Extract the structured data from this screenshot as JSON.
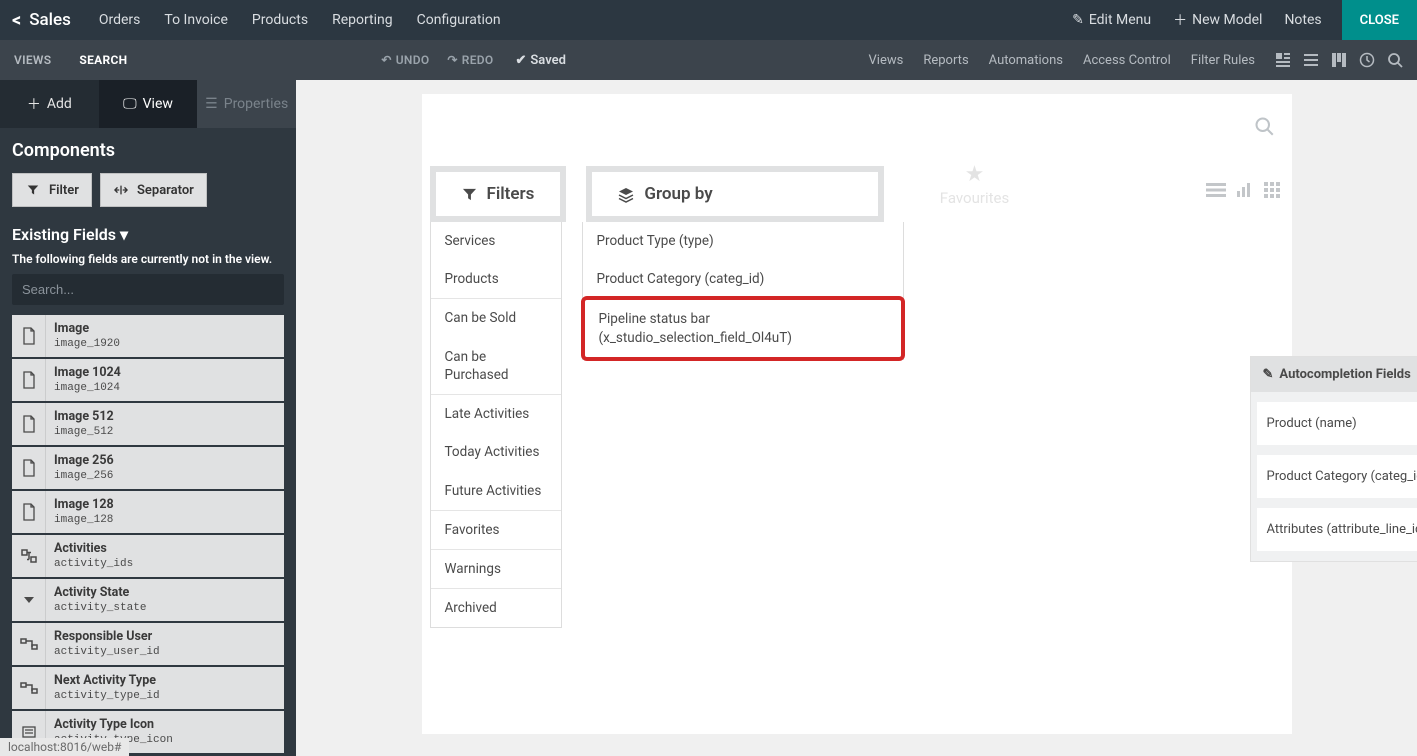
{
  "topbar": {
    "app": "Sales",
    "menus": [
      "Orders",
      "To Invoice",
      "Products",
      "Reporting",
      "Configuration"
    ],
    "edit_menu": "Edit Menu",
    "new_model": "New Model",
    "notes": "Notes",
    "close": "CLOSE"
  },
  "toolbar2": {
    "tabs": {
      "views": "VIEWS",
      "search": "SEARCH"
    },
    "undo": "UNDO",
    "redo": "REDO",
    "saved": "Saved",
    "rlinks": [
      "Views",
      "Reports",
      "Automations",
      "Access Control",
      "Filter Rules"
    ]
  },
  "side_tabs": {
    "add": "Add",
    "view": "View",
    "props": "Properties"
  },
  "components": {
    "title": "Components",
    "filter": "Filter",
    "separator": "Separator"
  },
  "existing": {
    "title": "Existing Fields",
    "subtitle": "The following fields are currently not in the view.",
    "search_placeholder": "Search..."
  },
  "fields": [
    {
      "label": "Image",
      "code": "image_1920",
      "icon": "file"
    },
    {
      "label": "Image 1024",
      "code": "image_1024",
      "icon": "file"
    },
    {
      "label": "Image 512",
      "code": "image_512",
      "icon": "file"
    },
    {
      "label": "Image 256",
      "code": "image_256",
      "icon": "file"
    },
    {
      "label": "Image 128",
      "code": "image_128",
      "icon": "file"
    },
    {
      "label": "Activities",
      "code": "activity_ids",
      "icon": "link"
    },
    {
      "label": "Activity State",
      "code": "activity_state",
      "icon": "select"
    },
    {
      "label": "Responsible User",
      "code": "activity_user_id",
      "icon": "rel"
    },
    {
      "label": "Next Activity Type",
      "code": "activity_type_id",
      "icon": "rel"
    },
    {
      "label": "Activity Type Icon",
      "code": "activity_type_icon",
      "icon": "text"
    }
  ],
  "canvas": {
    "filters_tab": "Filters",
    "groupby_tab": "Group by",
    "favourites": "Favourites",
    "filters": [
      "Services",
      "Products",
      "Can be Sold",
      "Can be Purchased",
      "Late Activities",
      "Today Activities",
      "Future Activities",
      "Favorites",
      "Warnings",
      "Archived"
    ],
    "filter_groups": [
      [
        0,
        1
      ],
      [
        2,
        3
      ],
      [
        4,
        5,
        6
      ],
      [
        7
      ],
      [
        8
      ],
      [
        9
      ]
    ],
    "groupby": [
      "Product Type (type)",
      "Product Category (categ_id)",
      "Pipeline status bar (x_studio_selection_field_Ol4uT)"
    ],
    "autocomplete": {
      "title": "Autocompletion Fields",
      "items": [
        "Product (name)",
        "Product Category (categ_id)",
        "Attributes (attribute_line_ids)"
      ]
    }
  },
  "status_bar": "localhost:8016/web#"
}
